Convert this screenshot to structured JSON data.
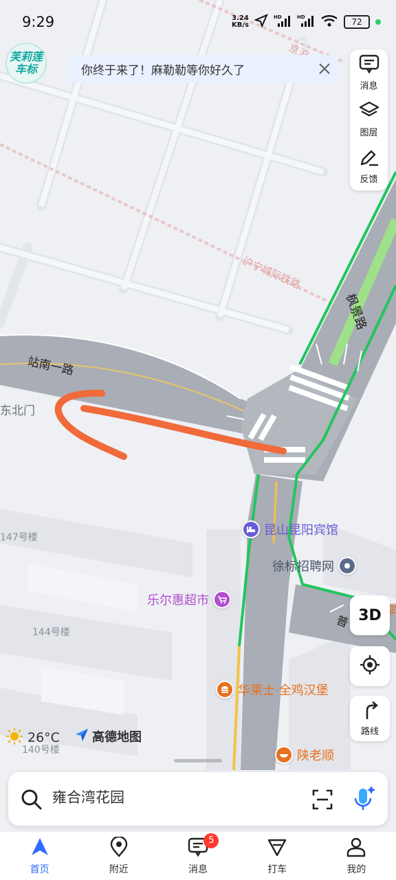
{
  "status_bar": {
    "time": "9:29",
    "net_speed_top": "3.24",
    "net_speed_bottom": "KB/s",
    "battery": "72"
  },
  "logo": {
    "line1": "芙莉莲",
    "line2": "车标"
  },
  "banner": {
    "text": "你终于来了！麻勒勒等你好久了"
  },
  "tools": {
    "messages": "消息",
    "layers": "图层",
    "feedback": "反馈"
  },
  "map": {
    "roads": {
      "station_south_road": "站南一路",
      "fengjing_road": "枫景路"
    },
    "railway": "沪宁城际铁路",
    "railway_partial": "京沪",
    "labels": {
      "north_east_gate": "东北门",
      "bldg_147": "147号楼",
      "bldg_144": "144号楼",
      "bldg_140": "140号楼",
      "pu_road_partial": "普",
      "edge_partial": "武"
    },
    "pois": [
      {
        "name": "昆山昆阳宾馆",
        "color": "#6b5bd6"
      },
      {
        "name": "徐标招聘网",
        "color": "#5a6b8c"
      },
      {
        "name": "乐尔惠超市",
        "color": "#b24fcf"
      },
      {
        "name": "华莱士·全鸡汉堡",
        "color": "#e8711f"
      },
      {
        "name": "陕老顺",
        "color": "#e8711f"
      }
    ]
  },
  "controls": {
    "three_d": "3D",
    "route": "路线"
  },
  "weather": {
    "temp": "26°C"
  },
  "brand": {
    "name": "高德地图"
  },
  "search": {
    "value": "雍合湾花园"
  },
  "nav": {
    "items": [
      {
        "label": "首页"
      },
      {
        "label": "附近"
      },
      {
        "label": "消息",
        "badge": "5"
      },
      {
        "label": "打车"
      },
      {
        "label": "我的"
      }
    ]
  },
  "colors": {
    "accent": "#2f6bff",
    "route_green": "#22c55e",
    "annotation": "#f06a3a",
    "road_gray": "#a9adb5"
  }
}
